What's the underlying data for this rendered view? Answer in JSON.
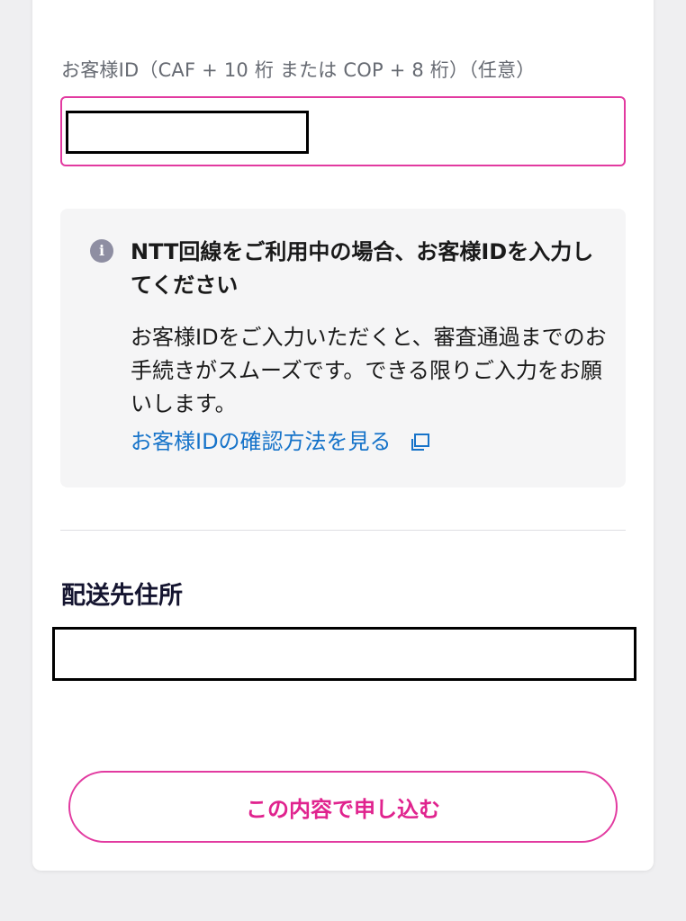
{
  "form": {
    "customer_id_label": "お客様ID（CAF + 10 桁 または COP + 8 桁）（任意）",
    "customer_id_value": ""
  },
  "info": {
    "icon": "info-icon",
    "icon_glyph": "i",
    "title": "NTT回線をご利用中の場合、お客様IDを入力してください",
    "body": "お客様IDをご入力いただくと、審査通過までのお手続きがスムーズです。できる限りご入力をお願いします。",
    "link_label": "お客様IDの確認方法を見る",
    "link_icon": "external-window-icon"
  },
  "shipping": {
    "title": "配送先住所",
    "address_value": ""
  },
  "actions": {
    "submit_label": "この内容で申し込む"
  },
  "colors": {
    "accent": "#e23aa0",
    "link": "#1673c9",
    "info_icon": "#8e8ea2"
  }
}
